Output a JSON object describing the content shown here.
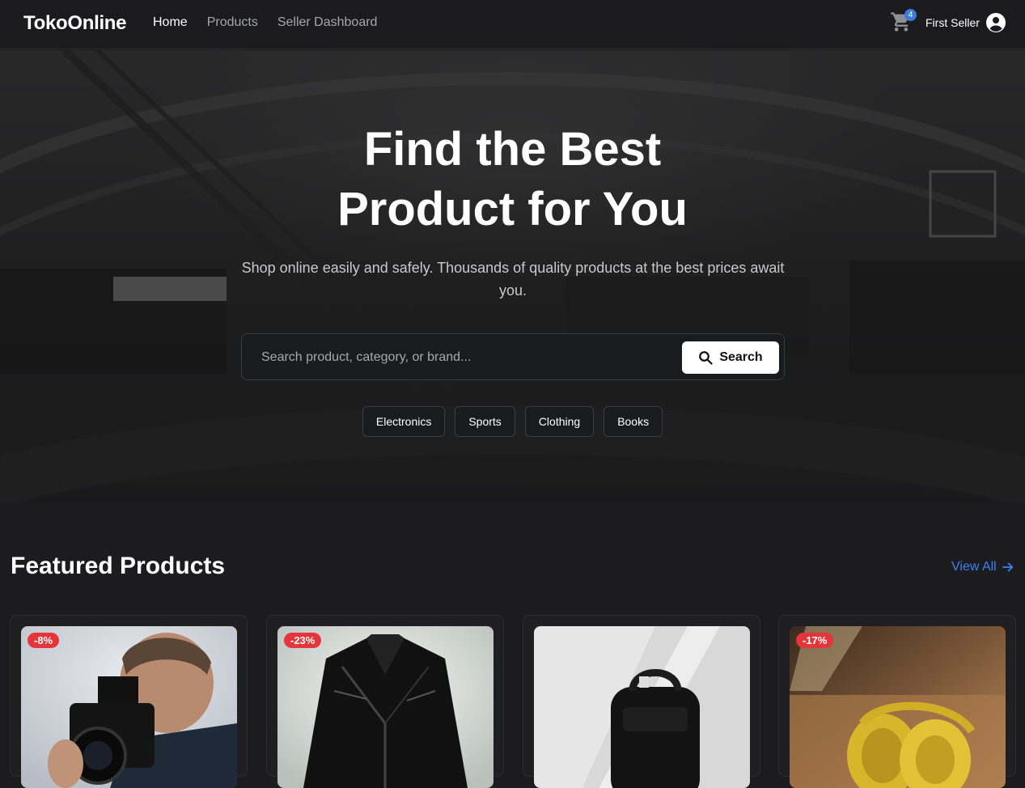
{
  "nav": {
    "brand": "TokoOnline",
    "links": [
      {
        "label": "Home",
        "active": true
      },
      {
        "label": "Products",
        "active": false
      },
      {
        "label": "Seller Dashboard",
        "active": false
      }
    ],
    "cart_count": "4",
    "cart_icon": "cart-icon",
    "user_name": "First Seller",
    "user_icon": "account-circle-icon"
  },
  "hero": {
    "title_line1": "Find the Best",
    "title_line2": "Product for You",
    "subtitle": "Shop online easily and safely. Thousands of quality products at the best prices await you.",
    "search_placeholder": "Search product, category, or brand...",
    "search_button": "Search",
    "categories": [
      "Electronics",
      "Sports",
      "Clothing",
      "Books"
    ]
  },
  "featured": {
    "title": "Featured Products",
    "view_all": "View All",
    "products": [
      {
        "discount": "-8%",
        "image": "camera-photographer"
      },
      {
        "discount": "-23%",
        "image": "leather-jacket"
      },
      {
        "discount": "",
        "image": "black-backpack"
      },
      {
        "discount": "-17%",
        "image": "yellow-headphones"
      }
    ]
  },
  "colors": {
    "accent": "#3b82f6",
    "badge": "#3b7ddd",
    "discount": "#e5343a",
    "background": "#1c1c1e"
  }
}
